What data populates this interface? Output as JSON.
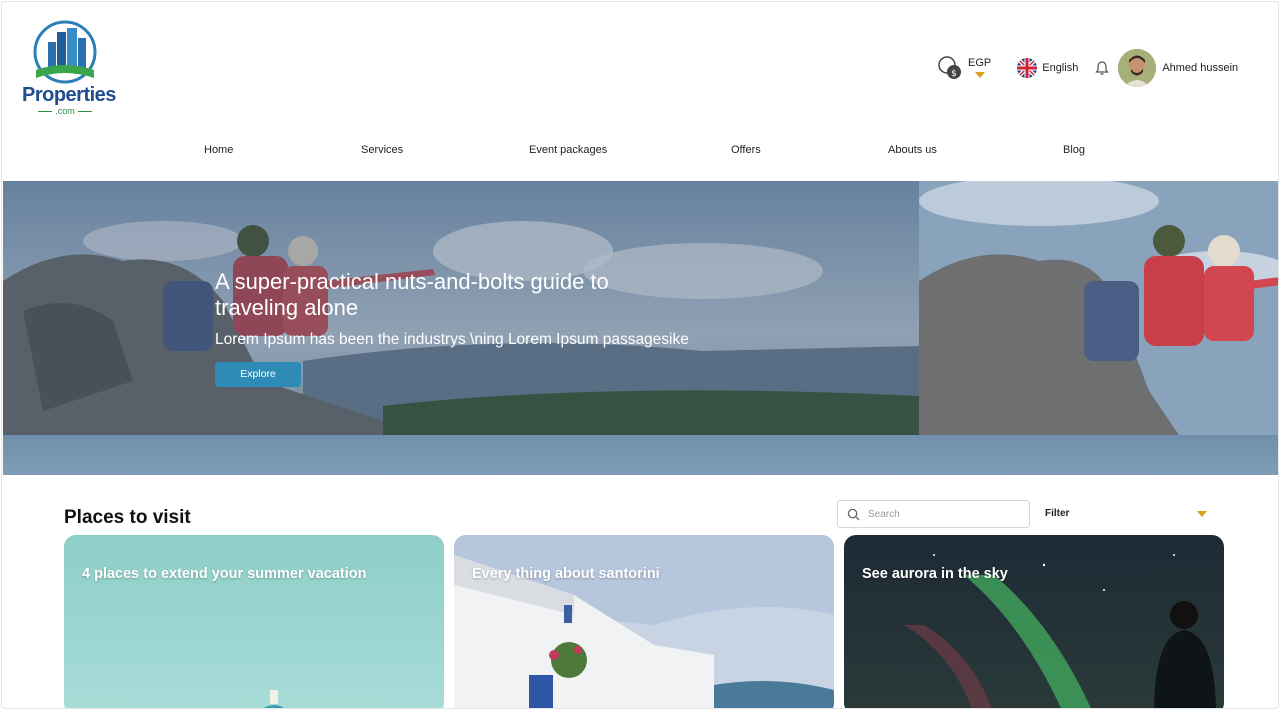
{
  "brand": {
    "name": "Properties",
    "suffix": ".com"
  },
  "header": {
    "currency": "EGP",
    "language": "English",
    "user_name": "Ahmed hussein"
  },
  "nav": [
    "Home",
    "Services",
    "Event packages",
    "Offers",
    "Abouts us",
    "Blog"
  ],
  "hero": {
    "title": "A super-practical nuts-and-bolts guide to traveling alone",
    "subtitle": "Lorem Ipsum has been the industrys \\ning Lorem Ipsum passagesike",
    "button": "Explore"
  },
  "places": {
    "title": "Places to visit",
    "search_placeholder": "Search",
    "filter_label": "Filter",
    "cards": [
      {
        "title": "4 places to extend your summer vacation"
      },
      {
        "title": "Every thing about santorini"
      },
      {
        "title": "See aurora in the sky"
      }
    ]
  },
  "colors": {
    "accent": "#2d8bb5",
    "caret": "#d8a21a",
    "brand_blue": "#1f4e8f",
    "brand_green": "#2f8f3f"
  }
}
